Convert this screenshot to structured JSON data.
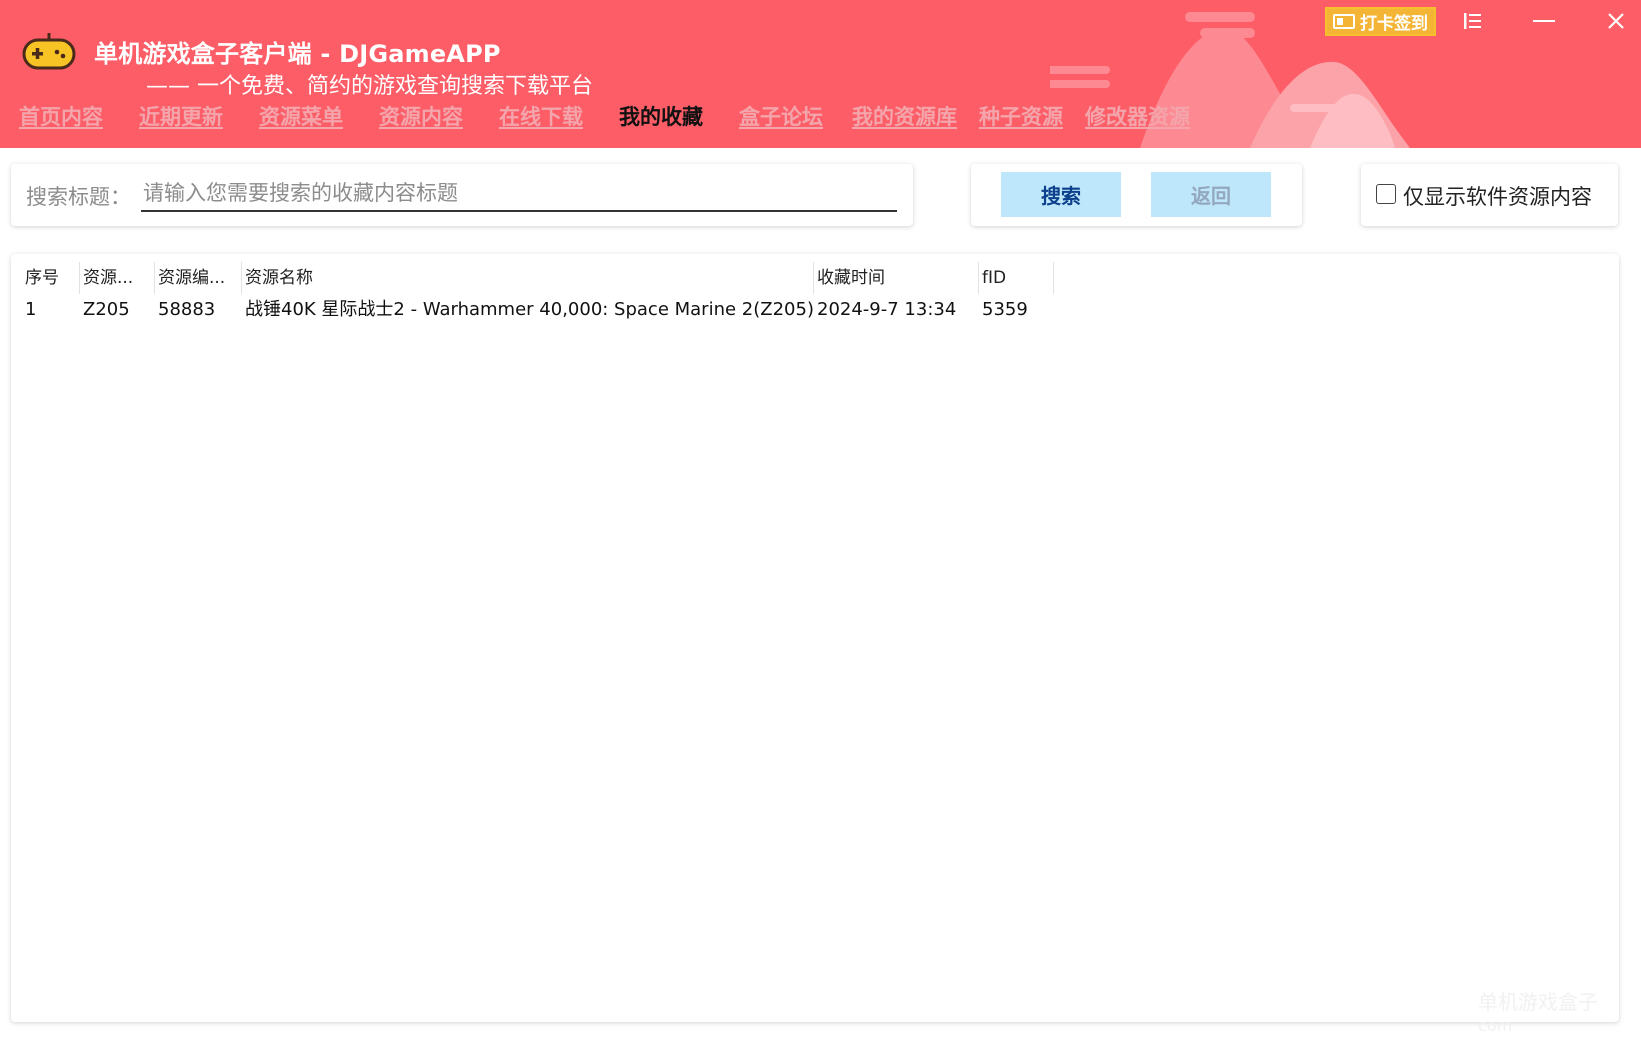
{
  "window": {
    "title": "单机游戏盒子客户端 - DJGameAPP",
    "subtitle": "—— 一个免费、简约的游戏查询搜索下载平台",
    "checkin_label": "打卡签到",
    "menu_icon": "list-menu-icon",
    "minimize_icon": "minimize-icon",
    "close_icon": "close-icon"
  },
  "nav": {
    "items": [
      {
        "label": "首页内容"
      },
      {
        "label": "近期更新"
      },
      {
        "label": "资源菜单"
      },
      {
        "label": "资源内容"
      },
      {
        "label": "在线下载"
      },
      {
        "label": "我的收藏",
        "active": true
      },
      {
        "label": "盒子论坛"
      },
      {
        "label": "我的资源库"
      },
      {
        "label": "种子资源"
      },
      {
        "label": "修改器资源"
      }
    ]
  },
  "search": {
    "label": "搜索标题：",
    "placeholder": "请输入您需要搜索的收藏内容标题",
    "value": "",
    "search_button": "搜索",
    "back_button": "返回"
  },
  "filter": {
    "checkbox_label": "仅显示软件资源内容",
    "checked": false
  },
  "table": {
    "columns": [
      "序号",
      "资源...",
      "资源编...",
      "资源名称",
      "收藏时间",
      "fID"
    ],
    "rows": [
      [
        "1",
        "Z205",
        "58883",
        "战锤40K 星际战士2 - Warhammer 40,000: Space Marine 2(Z205)",
        "2024-9-7 13:34",
        "5359"
      ]
    ]
  },
  "watermark": {
    "line1": "单机游戏盒子",
    "line2": "com"
  },
  "colors": {
    "header": "#fc5d67",
    "nav_inactive": "#f4a4ab",
    "button_bg": "#bee7fb",
    "checkin_bg": "#f4b436"
  }
}
